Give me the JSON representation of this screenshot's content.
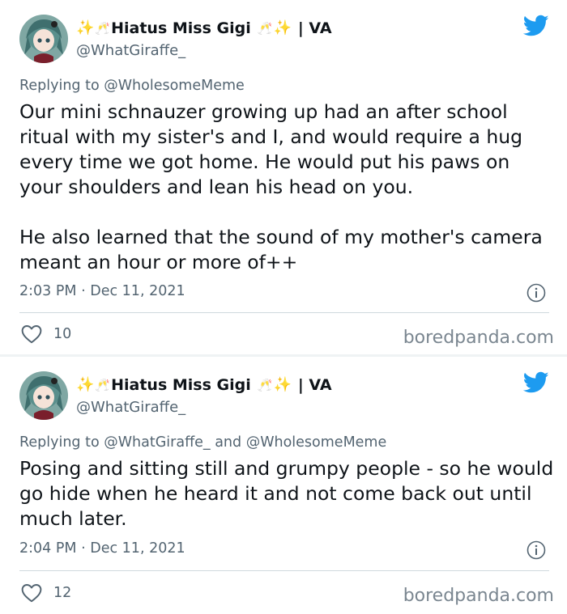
{
  "tweets": [
    {
      "display_name": "Hiatus Miss Gigi",
      "name_suffix": "| VA",
      "emoji_sparkle": "✨",
      "emoji_cheers": "🥂",
      "handle": "@WhatGiraffe_",
      "reply_prefix": "Replying to",
      "reply_mentions": "@WholesomeMeme",
      "text": "Our mini schnauzer growing up had an after school ritual with my sister's and I, and would require a hug every time we got home. He would put his paws on your shoulders and lean his head on you.\n\nHe also learned that the sound of my mother's camera meant an hour or more of++",
      "time": "2:03 PM",
      "dot": "·",
      "date": "Dec 11, 2021",
      "likes": "10",
      "watermark": "boredpanda.com"
    },
    {
      "display_name": "Hiatus Miss Gigi",
      "name_suffix": "| VA",
      "emoji_sparkle": "✨",
      "emoji_cheers": "🥂",
      "handle": "@WhatGiraffe_",
      "reply_prefix": "Replying to",
      "reply_mentions": "@WhatGiraffe_ and @WholesomeMeme",
      "text": "Posing and sitting still and grumpy people - so he would go hide when he heard it and not come back out until much later.",
      "time": "2:04 PM",
      "dot": "·",
      "date": "Dec 11, 2021",
      "likes": "12",
      "watermark": "boredpanda.com"
    }
  ],
  "colors": {
    "twitter_blue": "#1d9bf0",
    "secondary_text": "#536471",
    "primary_text": "#0f1419",
    "separator": "#cfd9de"
  },
  "icons": {
    "brand": "twitter-bird-icon",
    "info": "info-icon",
    "like": "heart-icon"
  }
}
